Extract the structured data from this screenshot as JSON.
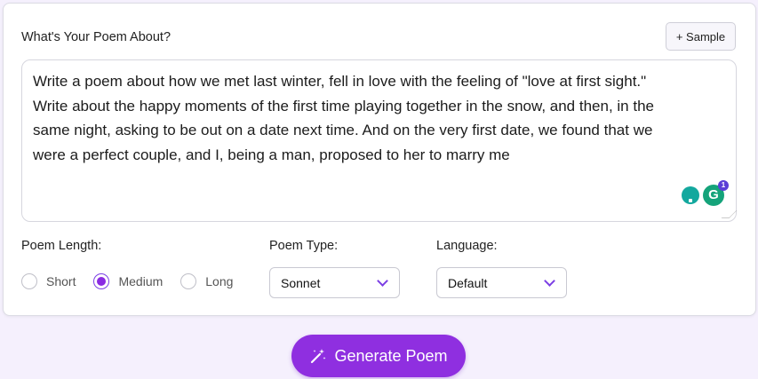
{
  "form": {
    "prompt_label": "What's Your Poem About?",
    "sample_label": "+ Sample",
    "prompt_lines": [
      "Write a poem about how we met last winter, fell in love with the feeling of \"love at first sight.\"",
      "Write about the happy moments of the first time playing together in the snow, and then, in the",
      "same night, asking to be out on a date next time. And on the very first date, we found that we",
      "were a perfect couple, and I, being a man, proposed to her to marry me"
    ],
    "grammarly_badge_count": "1"
  },
  "length": {
    "label": "Poem Length:",
    "options": [
      "Short",
      "Medium",
      "Long"
    ],
    "selected": "Medium"
  },
  "type": {
    "label": "Poem Type:",
    "value": "Sonnet"
  },
  "language": {
    "label": "Language:",
    "value": "Default"
  },
  "generate": {
    "label": "Generate Poem"
  },
  "icons": {
    "generate": "magic-wand-icon",
    "dropdown": "chevron-down-icon",
    "grammarly": "grammarly-icon"
  },
  "colors": {
    "accent": "#8f2fe0",
    "background": "#f5f0fd"
  }
}
